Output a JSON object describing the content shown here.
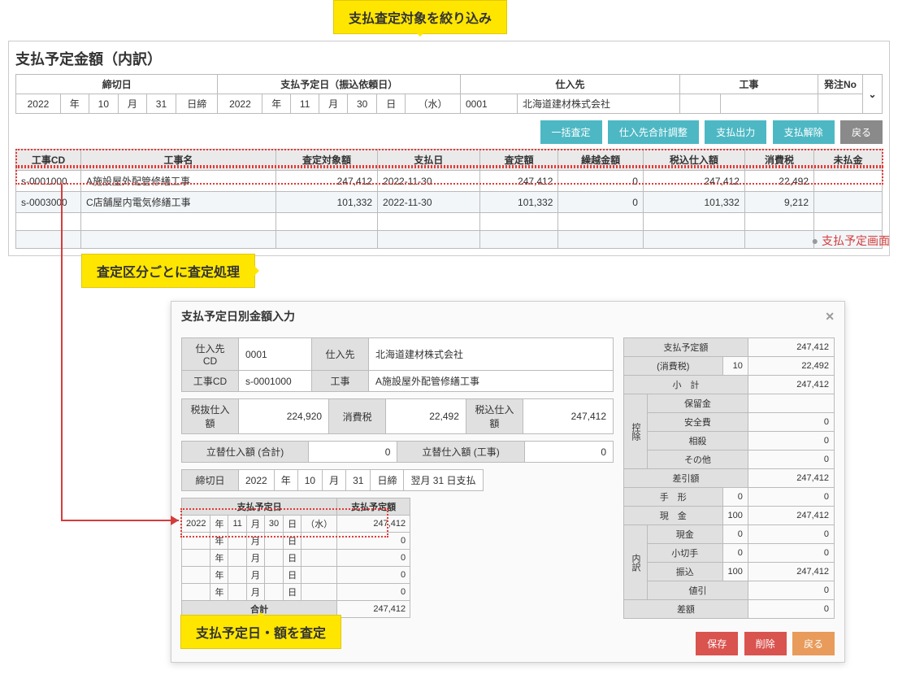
{
  "callouts": {
    "top": "支払査定対象を絞り込み",
    "mid": "査定区分ごとに査定処理",
    "bottom": "支払予定日・額を査定"
  },
  "top_panel": {
    "title": "支払予定金額（内訳）",
    "filter_headers": {
      "deadline": "締切日",
      "pay_date": "支払予定日（振込依頼日）",
      "supplier": "仕入先",
      "construction": "工事",
      "order_no": "発注No"
    },
    "filter_values": {
      "deadline_y": "2022",
      "deadline_yl": "年",
      "deadline_m": "10",
      "deadline_ml": "月",
      "deadline_d": "31",
      "deadline_dl": "日締",
      "pay_y": "2022",
      "pay_yl": "年",
      "pay_m": "11",
      "pay_ml": "月",
      "pay_d": "30",
      "pay_dl": "日",
      "pay_w": "（水）",
      "supplier_cd": "0001",
      "supplier_name": "北海道建材株式会社",
      "construction": "",
      "order_no": ""
    },
    "actions": {
      "bulk": "一括査定",
      "adjust": "仕入先合計調整",
      "output": "支払出力",
      "release": "支払解除",
      "back": "戻る"
    },
    "grid_headers": {
      "cd": "工事CD",
      "name": "工事名",
      "target": "査定対象額",
      "date": "支払日",
      "amount": "査定額",
      "carry": "繰越金額",
      "taxin": "税込仕入額",
      "tax": "消費税",
      "unpaid": "未払金"
    },
    "rows": [
      {
        "cd": "s-0001000",
        "name": "A施設屋外配管修繕工事",
        "target": "247,412",
        "date": "2022-11-30",
        "amount": "247,412",
        "carry": "0",
        "taxin": "247,412",
        "tax": "22,492",
        "unpaid": ""
      },
      {
        "cd": "s-0003000",
        "name": "C店舗屋内電気修繕工事",
        "target": "101,332",
        "date": "2022-11-30",
        "amount": "101,332",
        "carry": "0",
        "taxin": "101,332",
        "tax": "9,212",
        "unpaid": ""
      }
    ]
  },
  "caption": "支払予定画面",
  "dialog": {
    "title": "支払予定日別金額入力",
    "info": {
      "supplier_cd_lbl": "仕入先CD",
      "supplier_cd": "0001",
      "supplier_lbl": "仕入先",
      "supplier": "北海道建材株式会社",
      "const_cd_lbl": "工事CD",
      "const_cd": "s-0001000",
      "const_lbl": "工事",
      "const": "A施設屋外配管修繕工事",
      "ex_tax_lbl": "税抜仕入額",
      "ex_tax": "224,920",
      "tax_lbl": "消費税",
      "tax": "22,492",
      "inc_tax_lbl": "税込仕入額",
      "inc_tax": "247,412",
      "advance_total_lbl": "立替仕入額 (合計)",
      "advance_total": "0",
      "advance_const_lbl": "立替仕入額 (工事)",
      "advance_const": "0",
      "deadline_lbl": "締切日",
      "deadline_y": "2022",
      "yl": "年",
      "deadline_m": "10",
      "ml": "月",
      "deadline_d": "31",
      "dl": "日締",
      "pay_rule": "翌月 31 日支払"
    },
    "sched": {
      "h_date": "支払予定日",
      "h_amount": "支払予定額",
      "r1_y": "2022",
      "yl": "年",
      "r1_m": "11",
      "ml": "月",
      "r1_d": "30",
      "dl": "日",
      "r1_w": "（水）",
      "r1_a": "247,412",
      "empty_a": "0",
      "total_lbl": "合計",
      "total": "247,412"
    },
    "summary": {
      "planned_lbl": "支払予定額",
      "planned": "247,412",
      "tax_lbl": "(消費税)",
      "tax_pct": "10",
      "tax": "22,492",
      "subtotal_lbl": "小　計",
      "subtotal": "247,412",
      "deduct_lbl": "控除",
      "retain_lbl": "保留金",
      "retain": "",
      "safety_lbl": "安全費",
      "safety": "0",
      "offset_lbl": "相殺",
      "offset": "0",
      "other_lbl": "その他",
      "other": "0",
      "diff_lbl": "差引額",
      "diff": "247,412",
      "bill_lbl": "手　形",
      "bill_pct": "0",
      "bill": "0",
      "cash_lbl": "現　金",
      "cash_pct": "100",
      "cash": "247,412",
      "breakdown_lbl": "内訳",
      "cash2_lbl": "現金",
      "cash2_pct": "0",
      "cash2": "0",
      "check_lbl": "小切手",
      "check_pct": "0",
      "check": "0",
      "transfer_lbl": "振込",
      "transfer_pct": "100",
      "transfer": "247,412",
      "discount_lbl": "値引",
      "discount": "0",
      "balance_lbl": "差額",
      "balance": "0"
    },
    "footer": {
      "save": "保存",
      "delete": "削除",
      "back": "戻る"
    }
  }
}
